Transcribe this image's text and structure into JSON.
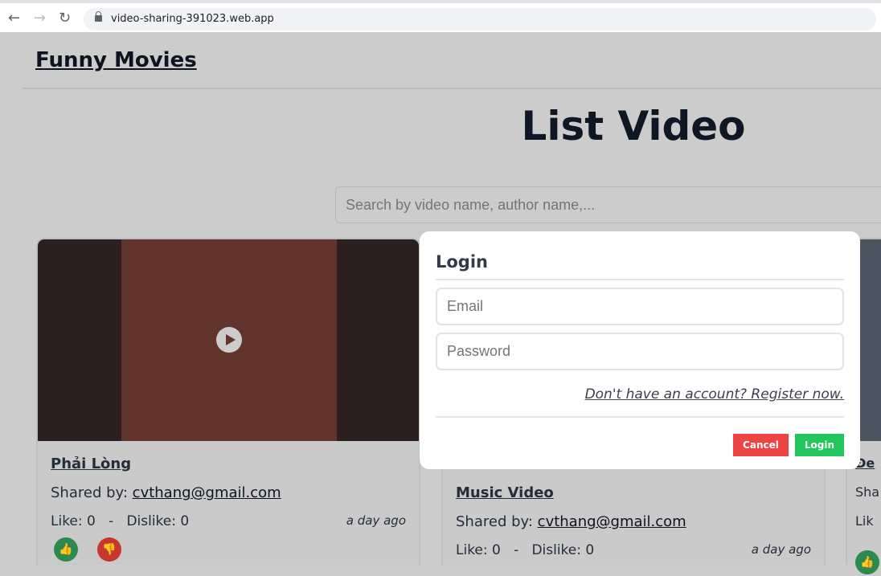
{
  "browser": {
    "url": "video-sharing-391023.web.app"
  },
  "header": {
    "brand": "Funny Movies"
  },
  "main": {
    "title": "List Video",
    "search_placeholder": "Search by video name, author name,..."
  },
  "cards": [
    {
      "title": "Phải Lòng",
      "shared_label": "Shared by:",
      "author": "cvthang@gmail.com",
      "like_label": "Like:",
      "likes": "0",
      "sep": "-",
      "dislike_label": "Dislike:",
      "dislikes": "0",
      "time": "a day ago"
    },
    {
      "title": "Music Video",
      "shared_label": "Shared by:",
      "author": "cvthang@gmail.com",
      "like_label": "Like:",
      "likes": "0",
      "sep": "-",
      "dislike_label": "Dislike:",
      "dislikes": "0",
      "time": "a day ago"
    },
    {
      "title": "Đe",
      "shared_label": "Sha",
      "like_label": "Lik"
    }
  ],
  "modal": {
    "title": "Login",
    "email_placeholder": "Email",
    "password_placeholder": "Password",
    "register_link": "Don't have an account? Register now.",
    "cancel": "Cancel",
    "login": "Login"
  },
  "colors": {
    "cancel": "#ef4444",
    "login": "#22c55e",
    "like": "#2a8a4f",
    "dislike": "#c8372d"
  }
}
